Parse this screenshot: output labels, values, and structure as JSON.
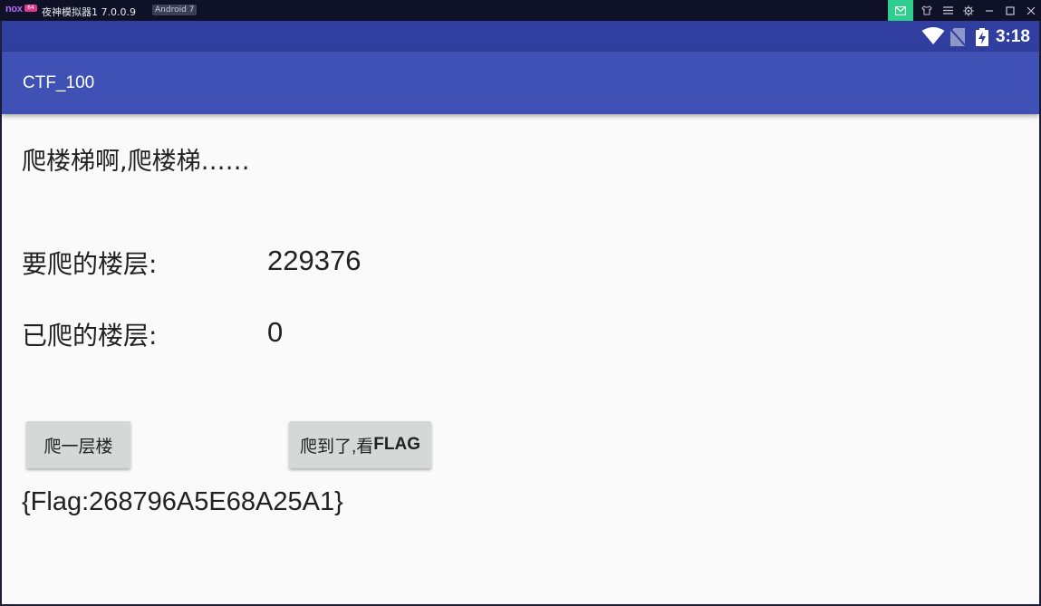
{
  "emulator": {
    "logo": "nox",
    "badge": "64",
    "title": "夜神模拟器1 7.0.0.9",
    "android_tag": "Android 7"
  },
  "status_bar": {
    "time": "3:18",
    "color": "#303f9f"
  },
  "app_bar": {
    "title": "CTF_100",
    "color": "#3f51b5"
  },
  "content": {
    "heading": "爬楼梯啊,爬楼梯……",
    "target_label": "要爬的楼层:",
    "target_value": "229376",
    "done_label": "已爬的楼层:",
    "done_value": "0",
    "flag_text": "{Flag:268796A5E68A25A1}"
  },
  "buttons": {
    "climb": "爬一层楼",
    "see_flag_prefix": "爬到了,看",
    "see_flag_suffix": "FLAG"
  }
}
